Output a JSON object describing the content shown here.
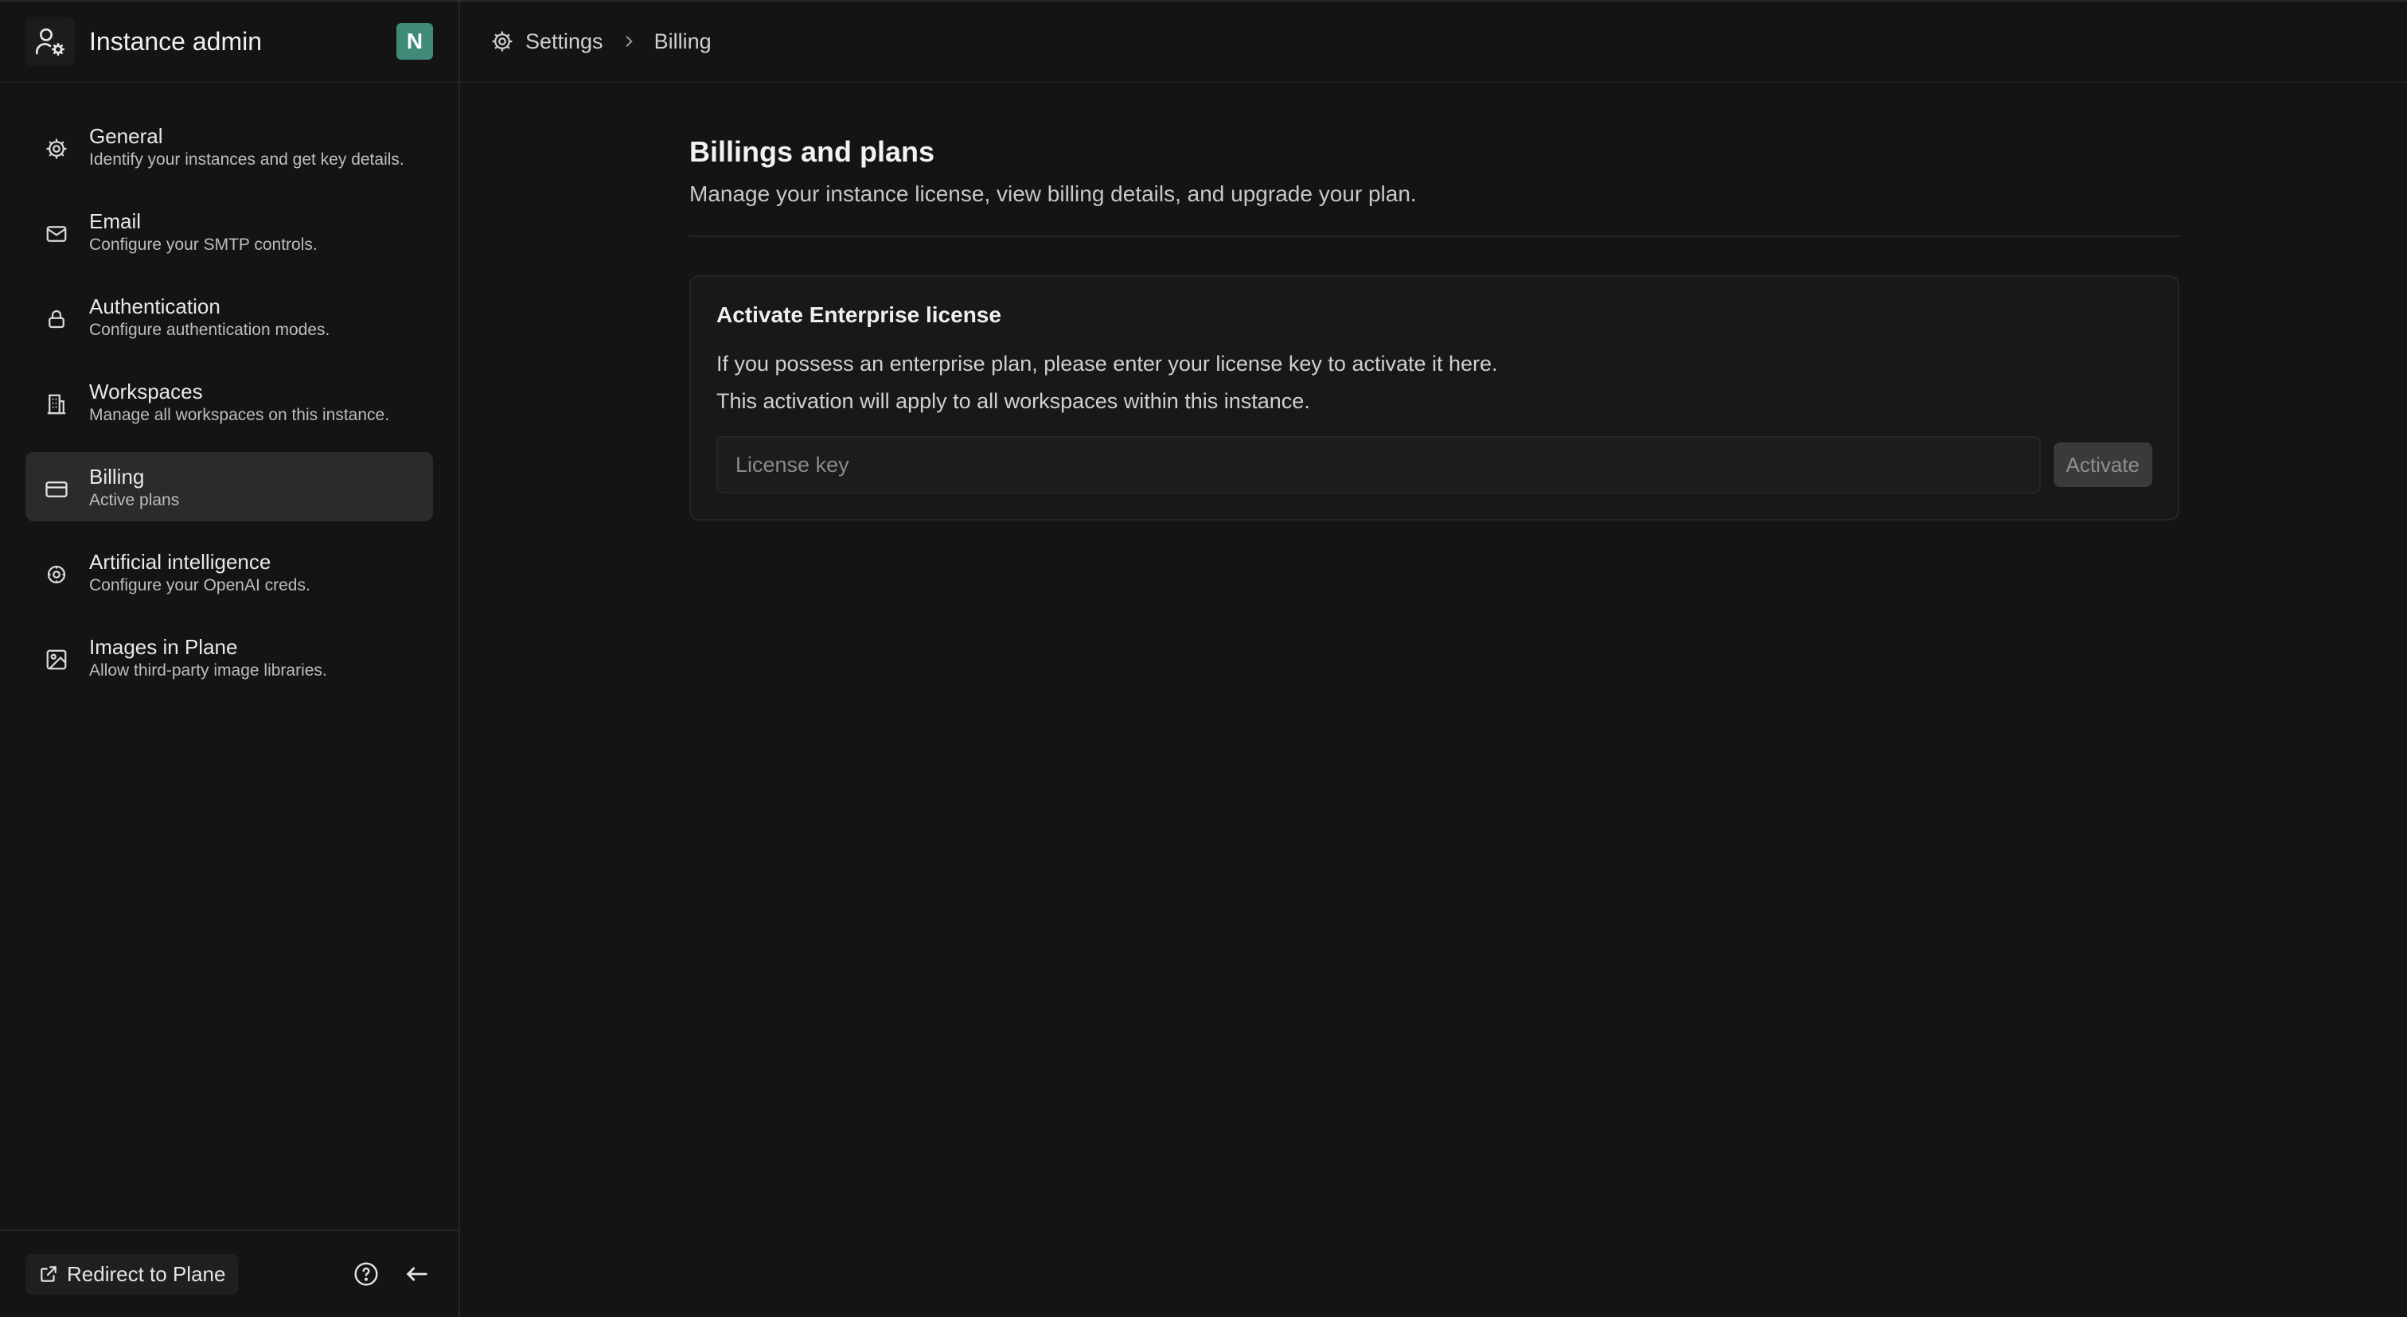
{
  "sidebar": {
    "title": "Instance admin",
    "avatar_initial": "N",
    "items": [
      {
        "label": "General",
        "description": "Identify your instances and get key details.",
        "icon": "gear-icon"
      },
      {
        "label": "Email",
        "description": "Configure your SMTP controls.",
        "icon": "mail-icon"
      },
      {
        "label": "Authentication",
        "description": "Configure authentication modes.",
        "icon": "lock-icon"
      },
      {
        "label": "Workspaces",
        "description": "Manage all workspaces on this instance.",
        "icon": "building-icon"
      },
      {
        "label": "Billing",
        "description": "Active plans",
        "icon": "credit-card-icon",
        "active": true
      },
      {
        "label": "Artificial intelligence",
        "description": "Configure your OpenAI creds.",
        "icon": "brain-gear-icon"
      },
      {
        "label": "Images in Plane",
        "description": "Allow third-party image libraries.",
        "icon": "image-icon"
      }
    ],
    "footer": {
      "redirect_label": "Redirect to Plane"
    }
  },
  "breadcrumb": {
    "items": [
      "Settings",
      "Billing"
    ]
  },
  "main": {
    "title": "Billings and plans",
    "subtitle": "Manage your instance license, view billing details, and upgrade your plan.",
    "card": {
      "title": "Activate Enterprise license",
      "line1": "If you possess an enterprise plan, please enter your license key to activate it here.",
      "line2": "This activation will apply to all workspaces within this instance.",
      "input_placeholder": "License key",
      "input_value": "",
      "activate_label": "Activate"
    }
  },
  "colors": {
    "background": "#141414",
    "avatar": "#3f8b77",
    "active_nav": "#2b2b2b"
  }
}
